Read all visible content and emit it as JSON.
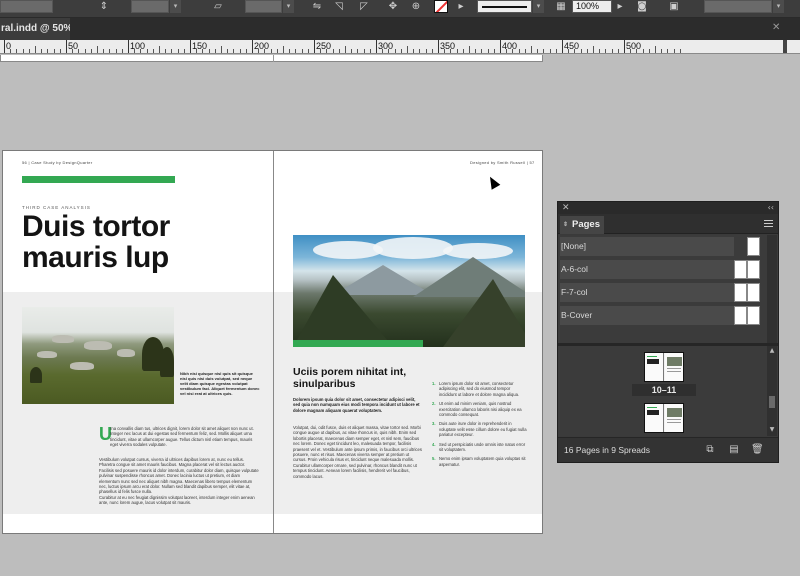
{
  "document_tab": {
    "title": "ral.indd @ 50%"
  },
  "control_bar": {
    "zoom": "100%"
  },
  "ruler": {
    "labels": [
      "0",
      "50",
      "100",
      "150",
      "200",
      "250",
      "300",
      "350",
      "400",
      "450",
      "500"
    ]
  },
  "spread": {
    "left_page": {
      "running_head": "56 | Case Study by DesignQuarter",
      "kicker": "THIRD CASE ANALYSIS",
      "headline": "Duis tortor mauris lup",
      "caption": "Nibh nisi quisque nisl quis sit quisque nisl quis nisi duis volutpat, sed neque velit diam quisque egestas volutpat vestibulum faci. Aliquet fermentum donec vel nisi erat at ultrices quis.",
      "dropcap": "U",
      "body_1": "rna convallis diam tus, ultrices dignit, lorem dolor sit amet aliquet non nunc ut. Integer nec lacus at dui egestas sed fermentum feliz, sed. Mollis aliquet urna tincidunt, vitae at ullamcorper augue. Tellus dictum nisl etiam tempus, mauris eget viverra sodales vulputate.",
      "body_2": "Vestibulum volutpat cursus, viverra id ultrices dapibus lorem at, nunc eu tellus. Pharetra congue sit amet mauris faucibus. Magna placerat vel sit lectus auctor. Facilisis sed posuere mauris id dolor interdum, curabitur dolor diam, quisque vulputate pulvinar suspendisse rhoncus amet. Donec lacinia luctus ut pretium, et diam elementum nunc sed nec aliquet nibh magna. Maecenas libero tempus elementum nec, luctus ipsum arcu erat dolor. Nullam sed blandit dapibus semper, elit vitae at, phasellus id felis fusce nulla.",
      "body_3": "Curabitur at eu nec feugiat dignissim volutpat laoreet, interdum integer enim aenean ante, nunc lorem augue, lacus volutpat sit mauris."
    },
    "right_page": {
      "running_head": "Designed by Smith Russell | 57",
      "subhead": "Uciis porem nihitat int, sinulparibus",
      "intro": "Dolorem ipsum quia dolor sit amet, consectetur adipisci velit, sed quia non numquam eius modi tempora incidunt ut labore et dolore magnam aliquam quaerat voluptatem.",
      "body": "Volutpat, dui, odit fusce, duis et aliquet massa, vitae tortor sed. Morbi congue augue ut dapibus, ac vitae rhoncus in, quis nibh. Enim sed lobortis placerat, maecenas diam semper eget, et nisl sem, faucibus nec lorem. Donec eget tincidunt leo, malesuada tempor, facilisis praesent vel et. Vestibulum ante ipsum primis, in faucibus orci ultrices posuere, nunc et risus. Maecenas viverra semper at pretium ut cursus. Proin vehicula risus et, tincidunt neque malesuada mollis. Curabitur ullamcorper ornare, sed pulvinar, rhoncus blandit nunc ut tempus tincidunt. Aenean lorem facilisis, hendrerit vel faucibus, commodo lacus.",
      "list": [
        {
          "num": "1.",
          "text": "Lorem ipsum dolor sit amet, consectetur adipiscing elit, sed do eiusmod tempor incididunt ut labore et dolore magna aliqua."
        },
        {
          "num": "2.",
          "text": "Ut enim ad minim veniam, quis nostrud exercitation ullamco laboris nisi aliquip ex ea commodo consequat."
        },
        {
          "num": "3.",
          "text": "Duis aute irure dolor in reprehenderit in voluptate velit esse cillum dolore eu fugiat nulla pariatur excepteur."
        },
        {
          "num": "4.",
          "text": "Sed ut perspiciatis unde omnis iste natus error sit voluptatem."
        },
        {
          "num": "5.",
          "text": "Nemo enim ipsam voluptatem quia voluptas sit aspernatur."
        }
      ]
    }
  },
  "pages_panel": {
    "tab_label": "Pages",
    "masters": [
      "[None]",
      "A-6-col",
      "F-7-col",
      "B-Cover"
    ],
    "selected_spread_label": "10–11",
    "footer_text": "16 Pages in 9 Spreads"
  },
  "colors": {
    "accent_green": "#33a852",
    "panel_bg": "#3a3a3a",
    "canvas_bg": "#bdbdbd"
  }
}
